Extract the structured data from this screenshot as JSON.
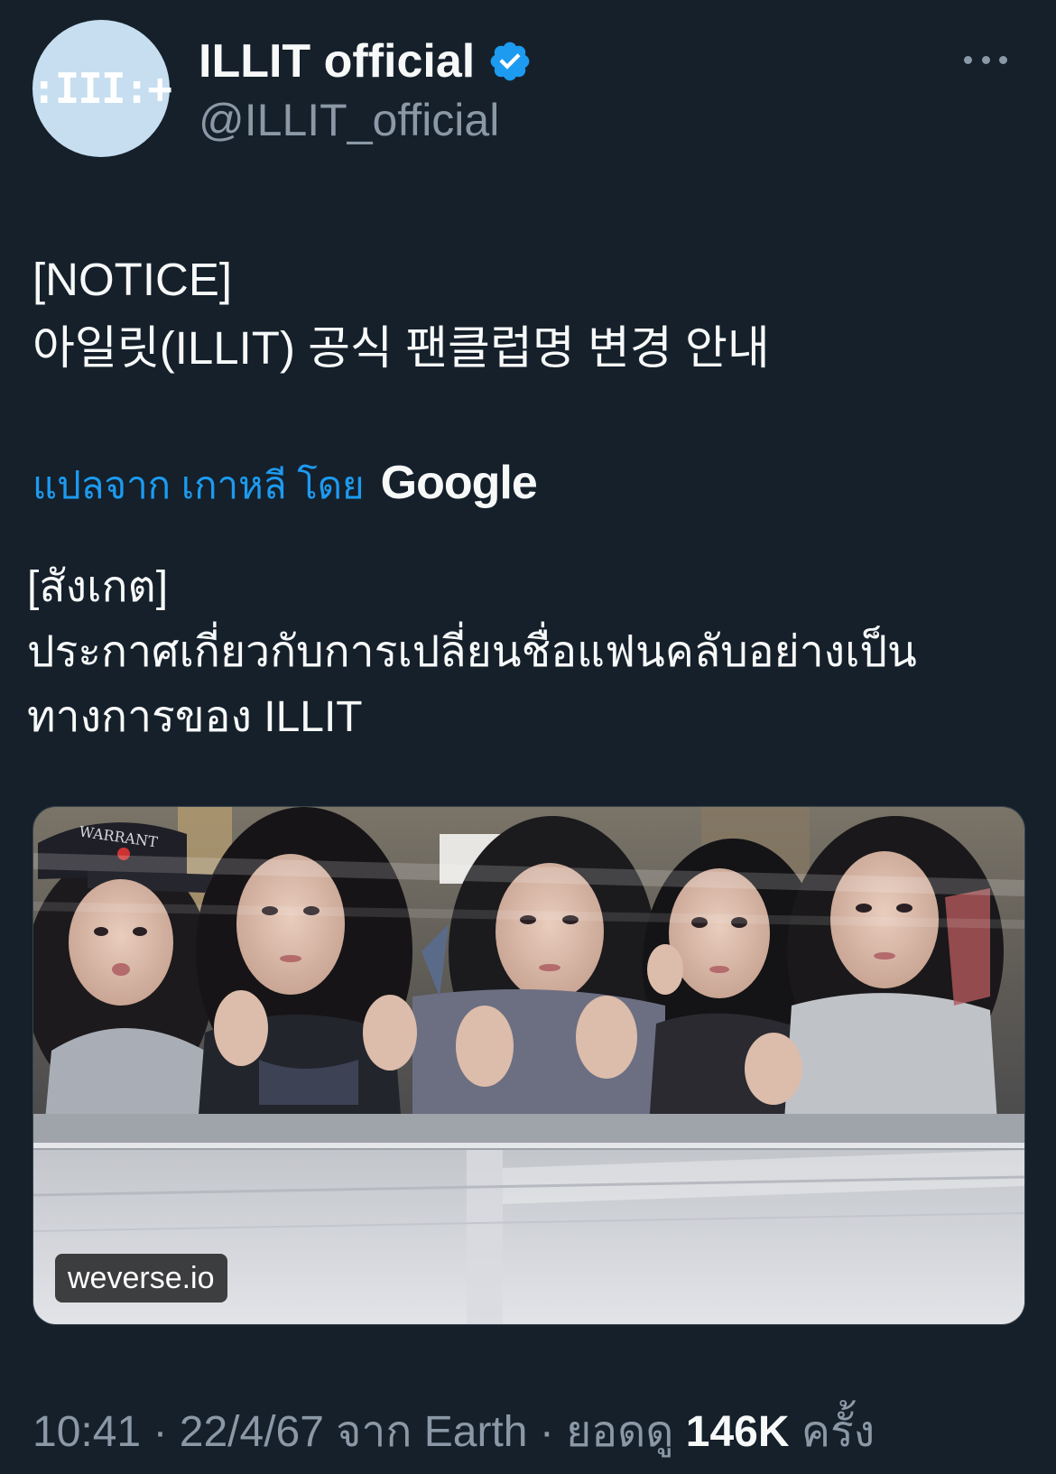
{
  "author": {
    "display_name": "ILLIT official",
    "handle": "@ILLIT_official",
    "avatar_text": ":III:+",
    "verified": true
  },
  "tweet": {
    "lines": [
      "[NOTICE]",
      "아일릿(ILLIT) 공식 팬클럽명 변경 안내"
    ],
    "translate_label": "แปลจาก เกาหลี โดย",
    "translate_provider": "Google",
    "translated_lines": [
      "[สังเกต]",
      "ประกาศเกี่ยวกับการเปลี่ยนชื่อแฟนคลับอย่างเป็น",
      "ทางการของ ILLIT"
    ]
  },
  "media": {
    "domain": "weverse.io",
    "cap_text": "WARRANT"
  },
  "meta": {
    "time": "10:41",
    "sep1": " · ",
    "date": "22/4/67",
    "source_prefix": " จาก ",
    "source": "Earth",
    "sep2": " · ",
    "views_label": "ยอดดู ",
    "views_count": "146K",
    "views_suffix": " ครั้ง"
  },
  "colors": {
    "background": "#15202b",
    "accent": "#1d9bf0",
    "secondary_text": "#8b98a5",
    "verified_badge": "#1d9bf0"
  },
  "icons": [
    "verified-badge-icon",
    "more-options-icon"
  ]
}
